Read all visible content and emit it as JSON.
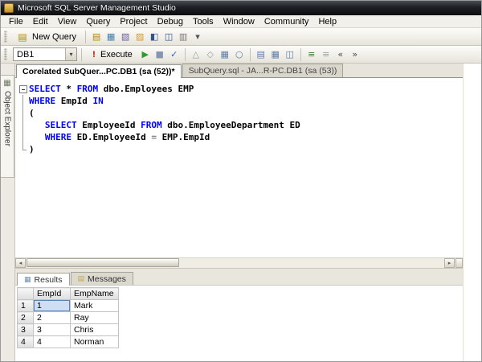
{
  "window": {
    "title": "Microsoft SQL Server Management Studio"
  },
  "menu": {
    "items": [
      "File",
      "Edit",
      "View",
      "Query",
      "Project",
      "Debug",
      "Tools",
      "Window",
      "Community",
      "Help"
    ]
  },
  "toolbar_standard": {
    "new_query_label": "New Query",
    "new_query_glyph": "▤",
    "icons": [
      {
        "name": "new-database-engine-query-icon",
        "glyph": "▤",
        "color": "#b8860b"
      },
      {
        "name": "new-analysis-services-query-icon",
        "glyph": "▦",
        "color": "#3f7fae"
      },
      {
        "name": "new-mdx-query-icon",
        "glyph": "▧",
        "color": "#6b5fa0"
      },
      {
        "name": "open-file-icon",
        "glyph": "▨",
        "color": "#d89c2a"
      },
      {
        "name": "save-icon",
        "glyph": "◧",
        "color": "#31548e"
      },
      {
        "name": "save-all-icon",
        "glyph": "◫",
        "color": "#31548e"
      },
      {
        "name": "print-icon",
        "glyph": "▥",
        "color": "#777777"
      },
      {
        "name": "toolbar-options-dropdown-icon",
        "glyph": "▾",
        "color": "#555555"
      }
    ]
  },
  "toolbar_query": {
    "database_value": "DB1",
    "combo_arrow_glyph": "▾",
    "execute_glyph": "!",
    "execute_label": "Execute",
    "right_icons": [
      {
        "name": "debug-icon",
        "glyph": "▶",
        "color": "#2e9b2e"
      },
      {
        "name": "cancel-query-icon",
        "glyph": "■",
        "color": "#8296b4"
      },
      {
        "name": "parse-icon",
        "glyph": "✓",
        "color": "#2f66c4"
      },
      {
        "sep": true
      },
      {
        "name": "display-estimated-plan-icon",
        "glyph": "△",
        "color": "#9aa0a6"
      },
      {
        "name": "query-options-icon",
        "glyph": "◇",
        "color": "#9aa0a6"
      },
      {
        "name": "include-actual-plan-icon",
        "glyph": "▦",
        "color": "#5a7da8"
      },
      {
        "name": "include-client-statistics-icon",
        "glyph": "○",
        "color": "#5a7da8"
      },
      {
        "sep": true
      },
      {
        "name": "results-to-text-icon",
        "glyph": "▤",
        "color": "#5a7da8"
      },
      {
        "name": "results-to-grid-icon",
        "glyph": "▦",
        "color": "#5a7da8"
      },
      {
        "name": "results-to-file-icon",
        "glyph": "◫",
        "color": "#5a7da8"
      },
      {
        "sep": true
      },
      {
        "name": "comment-out-lines-icon",
        "glyph": "≡",
        "color": "#3c7a3c"
      },
      {
        "name": "uncomment-lines-icon",
        "glyph": "≡",
        "color": "#9aa0a6"
      },
      {
        "name": "decrease-indent-icon",
        "glyph": "«",
        "color": "#4a4a4a"
      },
      {
        "name": "increase-indent-icon",
        "glyph": "»",
        "color": "#4a4a4a"
      }
    ]
  },
  "document_tabs": [
    {
      "label": "Corelated SubQuer...PC.DB1 (sa (52))*",
      "active": true
    },
    {
      "label": "SubQuery.sql - JA...R-PC.DB1 (sa (53))",
      "active": false
    }
  ],
  "object_explorer": {
    "label": "Object Explorer",
    "icon_glyph": "▦"
  },
  "editor": {
    "syntax_colors": {
      "keyword": "#0000ff",
      "plain": "#000000",
      "operator": "#808080"
    },
    "lines": [
      {
        "segs": [
          {
            "t": "SELECT",
            "c": "kw"
          },
          {
            "t": " * ",
            "c": "pl"
          },
          {
            "t": "FROM",
            "c": "kw"
          },
          {
            "t": " dbo.Employees EMP",
            "c": "pl"
          }
        ]
      },
      {
        "segs": [
          {
            "t": "WHERE",
            "c": "kw"
          },
          {
            "t": " EmpId ",
            "c": "pl"
          },
          {
            "t": "IN",
            "c": "kw"
          }
        ]
      },
      {
        "segs": [
          {
            "t": "(",
            "c": "pl"
          }
        ]
      },
      {
        "segs": [
          {
            "t": "   ",
            "c": "pl"
          },
          {
            "t": "SELECT",
            "c": "kw"
          },
          {
            "t": " EmployeeId ",
            "c": "pl"
          },
          {
            "t": "FROM",
            "c": "kw"
          },
          {
            "t": " dbo.EmployeeDepartment ED",
            "c": "pl"
          }
        ]
      },
      {
        "segs": [
          {
            "t": "   ",
            "c": "pl"
          },
          {
            "t": "WHERE",
            "c": "kw"
          },
          {
            "t": " ED.EmployeeId ",
            "c": "pl"
          },
          {
            "t": "=",
            "c": "op"
          },
          {
            "t": " EMP.EmpId",
            "c": "pl"
          }
        ]
      },
      {
        "segs": [
          {
            "t": ")",
            "c": "pl"
          }
        ]
      }
    ]
  },
  "results": {
    "tabs": [
      {
        "label": "Results",
        "icon": "grid",
        "icon_glyph": "▦",
        "icon_color": "#6f8fb4",
        "active": true
      },
      {
        "label": "Messages",
        "icon": "note",
        "icon_glyph": "▤",
        "icon_color": "#c2a64b",
        "active": false
      }
    ],
    "columns": [
      "EmpId",
      "EmpName"
    ],
    "row_numbers": [
      "1",
      "2",
      "3",
      "4"
    ],
    "rows": [
      [
        "1",
        "Mark"
      ],
      [
        "2",
        "Ray"
      ],
      [
        "3",
        "Chris"
      ],
      [
        "4",
        "Norman"
      ]
    ],
    "selected_cell": {
      "row": 0,
      "column": 0
    }
  }
}
